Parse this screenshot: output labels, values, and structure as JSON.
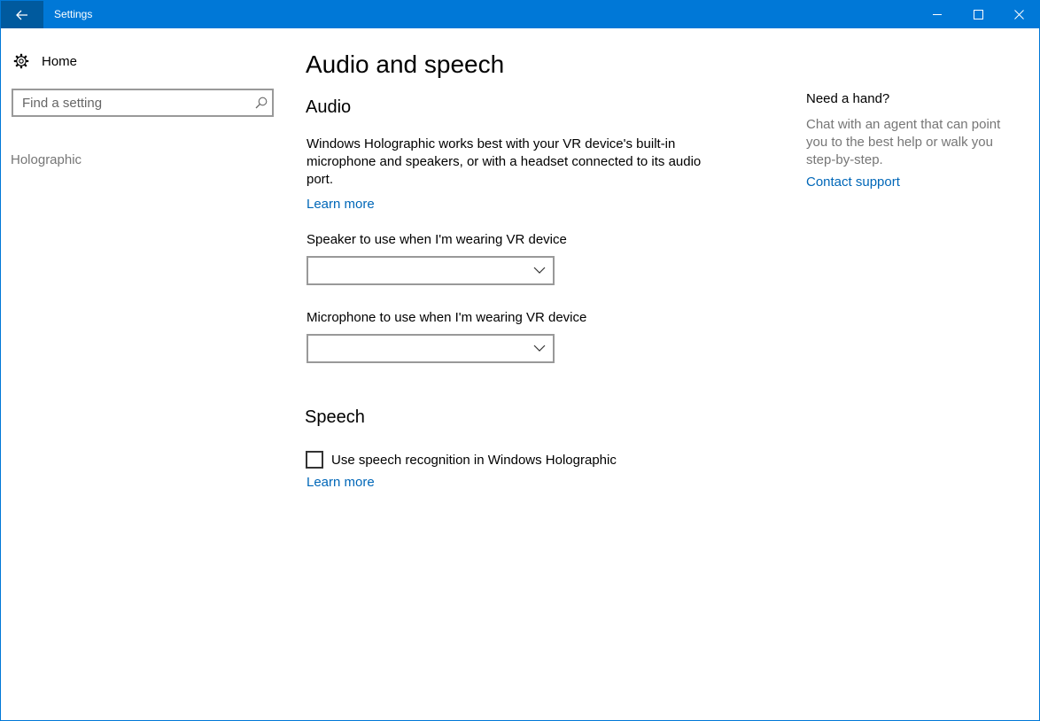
{
  "titlebar": {
    "title": "Settings",
    "back_icon": "back-arrow-icon",
    "minimize_icon": "minimize-icon",
    "maximize_icon": "maximize-icon",
    "close_icon": "close-icon",
    "background": "#0078d7",
    "back_button_background": "#005a9e"
  },
  "sidebar": {
    "home": {
      "label": "Home",
      "icon": "gear-icon"
    },
    "search": {
      "placeholder": "Find a setting",
      "value": "",
      "icon": "search-icon"
    },
    "items": [
      {
        "label": "Holographic"
      }
    ]
  },
  "main": {
    "title": "Audio and speech",
    "audio": {
      "heading": "Audio",
      "description": "Windows Holographic works best with your VR device's built-in microphone and speakers, or with a headset connected to its audio port.",
      "learn_more": "Learn more",
      "speaker_label": "Speaker to use when I'm wearing VR device",
      "speaker_value": "",
      "microphone_label": "Microphone to use when I'm wearing VR device",
      "microphone_value": ""
    },
    "speech": {
      "heading": "Speech",
      "checkbox_label": "Use speech recognition in Windows Holographic",
      "checkbox_checked": false,
      "learn_more": "Learn more"
    }
  },
  "help": {
    "title": "Need a hand?",
    "text": "Chat with an agent that can point you to the best help or walk you step-by-step.",
    "link": "Contact support"
  },
  "colors": {
    "accent": "#0078d7",
    "link": "#0067b8",
    "secondary_text": "#767676"
  }
}
